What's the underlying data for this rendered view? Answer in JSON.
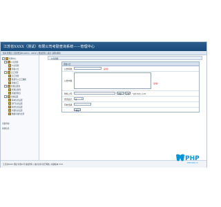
{
  "header": {
    "title": "江苏省XXXX（测试）有限公司考勤查询系统——管理中心"
  },
  "topbar": {
    "left": "您好:管理员 | 您的登录ID:admin",
    "right": "Admin | 修改密码 | 退出 | 刷新/重新"
  },
  "sidebar": {
    "items": [
      {
        "label": "管理中心"
      },
      {
        "label": "公告管理"
      },
      {
        "label": "公告管理"
      },
      {
        "label": "添加公告"
      },
      {
        "label": "员工管理"
      },
      {
        "label": "员工管理"
      },
      {
        "label": "批量导入员工数据"
      },
      {
        "label": "添加员工"
      },
      {
        "label": "管理员管理"
      },
      {
        "label": "管理员管理"
      },
      {
        "label": "添加管理员"
      },
      {
        "label": "系统设置"
      },
      {
        "label": "基本信息设置"
      },
      {
        "label": "部门信息设置"
      },
      {
        "label": "职位信息设置"
      },
      {
        "label": "考勤信息设置"
      },
      {
        "label": "数据库备份还原"
      }
    ],
    "footer_items": [
      {
        "label": "考勤查询"
      },
      {
        "label": "系统信息"
      }
    ]
  },
  "main": {
    "tab": "公告管理",
    "panel_title": "添加公告",
    "form": {
      "title_label": "公告标题：",
      "title_value": "",
      "title_required": "（必填）",
      "content_label": "公告内容：",
      "content_value": "",
      "content_required": "（必填）",
      "attach_label": "附件上传：",
      "browse_button": "浏览...",
      "upload_button": "上传",
      "upload_hint": "* 附件不得大于2M",
      "top_label": "置顶显示：",
      "top_value": "否",
      "effect_label": "有效日期：",
      "effect_value": "",
      "submit_button": "提交"
    }
  },
  "footer": {
    "text": "江苏省XXXX 测试 有限公司 版权所有 | 技术支持:佳汇网络 | 系统版本 V3.0"
  },
  "logo": {
    "text": "PHP",
    "sub": "www.php.cn"
  },
  "colors": {
    "header": "#174a7a",
    "accent": "#0095d9"
  }
}
